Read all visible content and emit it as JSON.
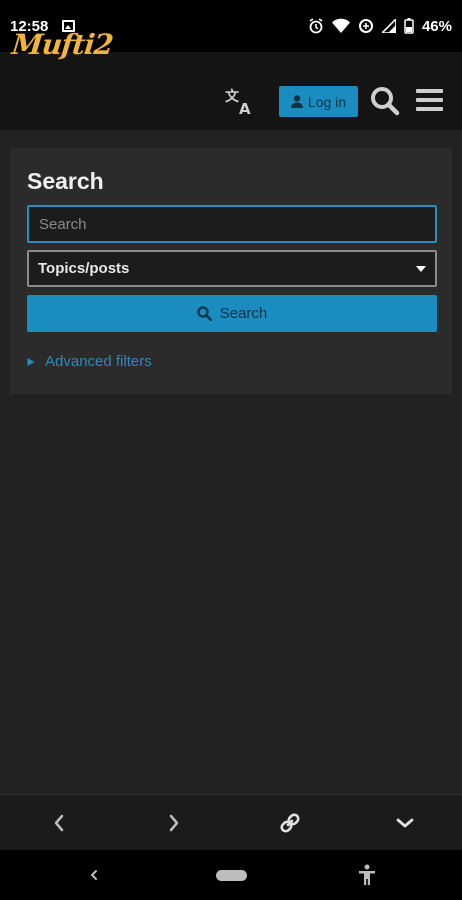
{
  "status_bar": {
    "time": "12:58",
    "battery": "46%"
  },
  "header": {
    "logo": "Mufti2",
    "login_label": "Log in"
  },
  "search_panel": {
    "title": "Search",
    "input_placeholder": "Search",
    "input_value": "",
    "scope_select": "Topics/posts",
    "search_button": "Search",
    "advanced_filters": "Advanced filters"
  },
  "colors": {
    "accent": "#1a8cc0",
    "logo": "#f0b43c",
    "background": "#222222",
    "panel": "#2b2b2b"
  },
  "icons": {
    "translate": "translate-icon",
    "user": "user-icon",
    "search": "search-icon",
    "menu": "hamburger-menu-icon",
    "back": "chevron-left-icon",
    "forward": "chevron-right-icon",
    "link": "link-icon",
    "more": "chevron-down-icon"
  }
}
